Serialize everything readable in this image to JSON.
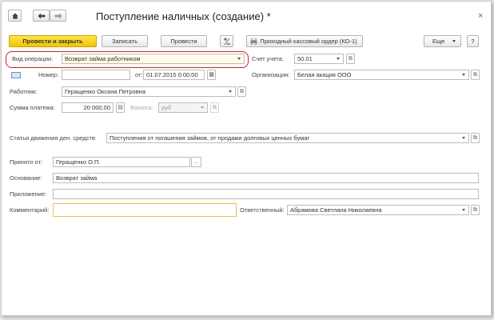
{
  "window": {
    "title": "Поступление наличных (создание) *",
    "close_glyph": "×"
  },
  "toolbar": {
    "post_close": "Провести и закрыть",
    "save": "Записать",
    "post": "Провести",
    "print_form": "Приходный кассовый ордер (КО-1)",
    "more": "Еще",
    "help": "?"
  },
  "form": {
    "op_type": {
      "label": "Вид операции:",
      "value": "Возврат займа работником"
    },
    "account": {
      "label": "Счет учета:",
      "value": "50.01"
    },
    "number": {
      "label": "Номер:",
      "value": ""
    },
    "date": {
      "label": "от:",
      "value": "01.07.2015  0:00:00"
    },
    "organization": {
      "label": "Организация:",
      "value": "Белая акация ООО"
    },
    "employee": {
      "label": "Работник:",
      "value": "Геращенко Оксана Петровна"
    },
    "amount": {
      "label": "Сумма платежа:",
      "value": "20 000,00"
    },
    "currency": {
      "label": "Валюта:",
      "value": "руб"
    },
    "cashflow": {
      "label": "Статья движения ден. средств:",
      "value": "Поступления от погашения займов, от продажи долговых ценных бумаг"
    },
    "received_from": {
      "label": "Принято от:",
      "value": "Геращенко О.П."
    },
    "basis": {
      "label": "Основание:",
      "value": "Возврат займа"
    },
    "attachment": {
      "label": "Приложение:",
      "value": ""
    },
    "comment": {
      "label": "Комментарий:",
      "value": ""
    },
    "responsible": {
      "label": "Ответственный:",
      "value": "Абрамова Светлана Николаевна"
    }
  },
  "colors": {
    "primary_button": "#f2c500",
    "highlight": "#d21f1f"
  }
}
